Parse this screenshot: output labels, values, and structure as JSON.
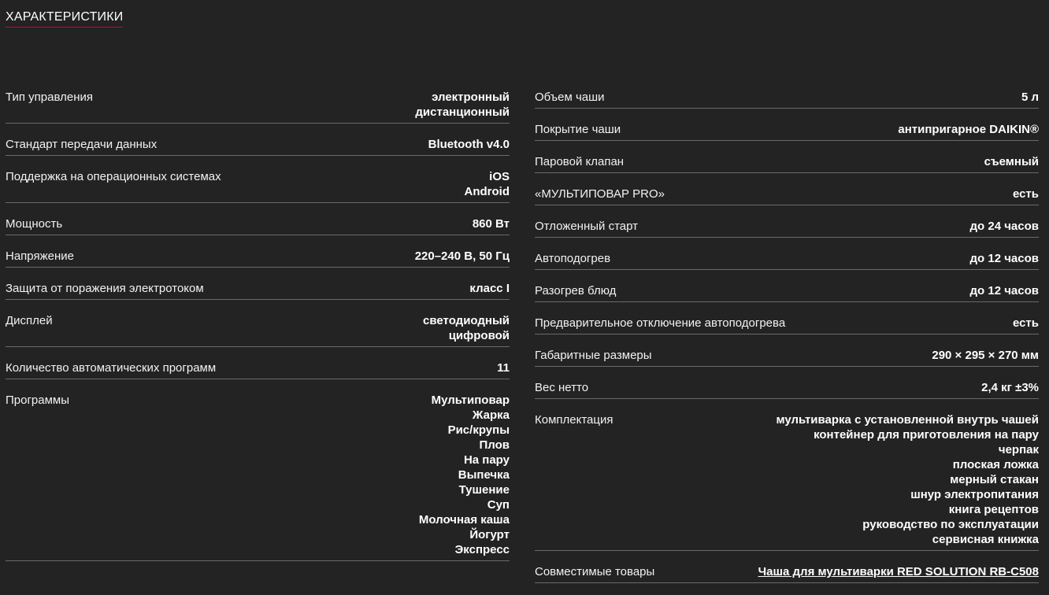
{
  "section_title": "ХАРАКТЕРИСТИКИ",
  "left_specs": [
    {
      "label": "Тип управления",
      "values": [
        "электронный",
        "дистанционный"
      ]
    },
    {
      "label": "Стандарт передачи данных",
      "values": [
        "Bluetooth v4.0"
      ]
    },
    {
      "label": "Поддержка на операционных системах",
      "values": [
        "iOS",
        "Android"
      ]
    },
    {
      "label": "Мощность",
      "values": [
        "860 Вт"
      ]
    },
    {
      "label": "Напряжение",
      "values": [
        "220–240 В, 50 Гц"
      ]
    },
    {
      "label": "Защита от поражения электротоком",
      "values": [
        "класс I"
      ]
    },
    {
      "label": "Дисплей",
      "values": [
        "светодиодный",
        "цифровой"
      ]
    },
    {
      "label": "Количество автоматических программ",
      "values": [
        "11"
      ]
    },
    {
      "label": "Программы",
      "values": [
        "Мультиповар",
        "Жарка",
        "Рис/крупы",
        "Плов",
        "На пару",
        "Выпечка",
        "Тушение",
        "Суп",
        "Молочная каша",
        "Йогурт",
        "Экспресс"
      ]
    }
  ],
  "right_specs": [
    {
      "label": "Объем чаши",
      "values": [
        "5 л"
      ]
    },
    {
      "label": "Покрытие чаши",
      "values": [
        "антипригарное DAIKIN®"
      ]
    },
    {
      "label": "Паровой клапан",
      "values": [
        "съемный"
      ]
    },
    {
      "label": "«МУЛЬТИПОВАР PRO»",
      "values": [
        "есть"
      ]
    },
    {
      "label": "Отложенный старт",
      "values": [
        "до 24 часов"
      ]
    },
    {
      "label": "Автоподогрев",
      "values": [
        "до 12 часов"
      ]
    },
    {
      "label": "Разогрев блюд",
      "values": [
        "до 12 часов"
      ]
    },
    {
      "label": "Предварительное отключение автоподогрева",
      "values": [
        "есть"
      ]
    },
    {
      "label": "Габаритные размеры",
      "values": [
        "290 × 295 × 270 мм"
      ]
    },
    {
      "label": "Вес нетто",
      "values": [
        "2,4 кг ±3%"
      ]
    },
    {
      "label": "Комплектация",
      "values": [
        "мультиварка с установленной внутрь чашей",
        "контейнер для приготовления на пару",
        "черпак",
        "плоская ложка",
        "мерный стакан",
        "шнур электропитания",
        "книга рецептов",
        "руководство по эксплуатации",
        "сервисная книжка"
      ]
    },
    {
      "label": "Совместимые товары",
      "values": [
        "Чаша для мультиварки RED SOLUTION RB-C508"
      ],
      "link": true
    }
  ],
  "colors": {
    "background": "#232323",
    "accent_underline": "#d6002b",
    "divider": "#6a6a6a"
  }
}
